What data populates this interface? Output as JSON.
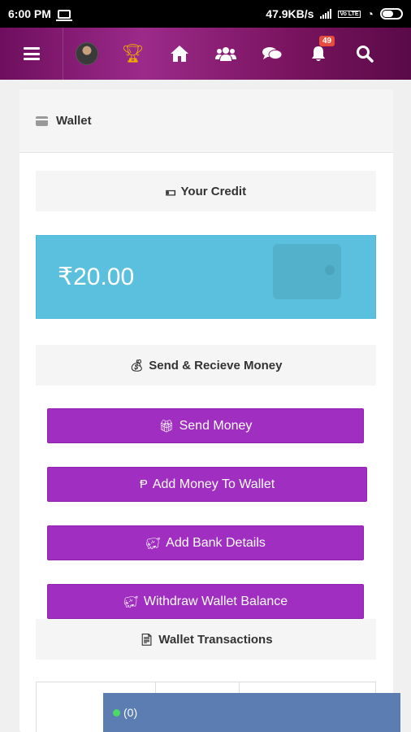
{
  "status_bar": {
    "time": "6:00 PM",
    "network_speed": "47.9KB/s",
    "volte_label": "Vo LTE"
  },
  "header": {
    "icons": [
      "menu-icon",
      "avatar",
      "trophy-icon",
      "home-icon",
      "friends-icon",
      "messages-icon",
      "notifications-icon",
      "search-icon"
    ],
    "notification_count": "49",
    "colors": {
      "gradient_start": "#6e0e5e",
      "gradient_mid": "#9c2a8a",
      "gradient_end": "#5a0a48",
      "trophy": "#f2a900",
      "badge": "#e74c3c"
    }
  },
  "panel": {
    "title": "Wallet",
    "credit_section_label": "Your Credit",
    "balance": "₹20.00",
    "send_receive_label": "Send & Recieve Money",
    "buttons": {
      "send_money": "Send Money",
      "add_money": "Add Money To Wallet",
      "add_bank": "Add Bank Details",
      "withdraw": "Withdraw Wallet Balance"
    },
    "transactions_label": "Wallet Transactions",
    "colors": {
      "balance_box": "#5bc0de",
      "button": "#a02ec0"
    }
  },
  "chat_bar": {
    "label": "(0)",
    "online_color": "#4cd964",
    "background": "#5b7db1"
  }
}
